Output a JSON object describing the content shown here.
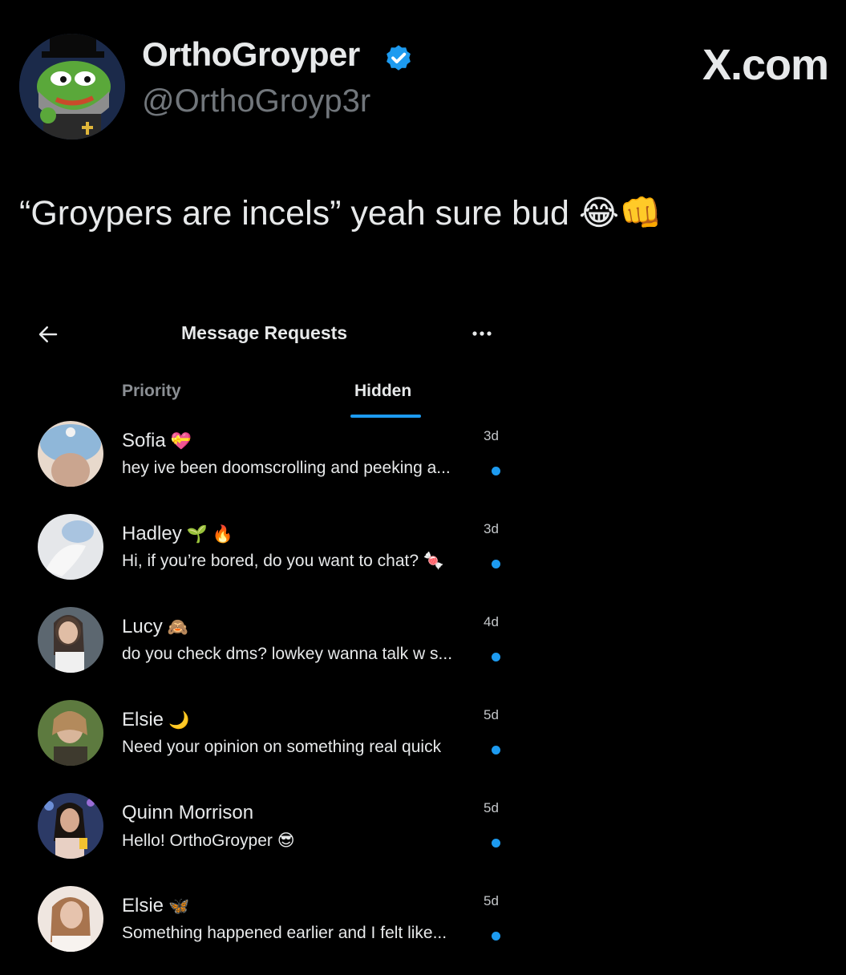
{
  "tweet": {
    "author_name": "OrthoGroyper",
    "author_handle": "@OrthoGroyp3r",
    "verified": true,
    "watermark": "X.com",
    "text": "“Groypers are incels” yeah sure bud 😂👊"
  },
  "dm_screen": {
    "title": "Message Requests",
    "tabs": [
      {
        "label": "Priority",
        "active": false
      },
      {
        "label": "Hidden",
        "active": true
      }
    ],
    "conversations": [
      {
        "name": "Sofia",
        "name_emoji": "💝",
        "time": "3d",
        "preview": "hey ive been doomscrolling and peeking a...",
        "unread": true,
        "avatar_color": "#8fb7d9"
      },
      {
        "name": "Hadley",
        "name_emoji": "🌱 🔥",
        "time": "3d",
        "preview": "Hi, if you’re bored, do you want to chat? 🍬",
        "unread": true,
        "avatar_color": "#d9dde3"
      },
      {
        "name": "Lucy",
        "name_emoji": "🙈",
        "time": "4d",
        "preview": "do you check dms? lowkey wanna talk w s...",
        "unread": true,
        "avatar_color": "#6e6258"
      },
      {
        "name": "Elsie",
        "name_emoji": "🌙",
        "time": "5d",
        "preview": "Need your opinion on something real quick",
        "unread": true,
        "avatar_color": "#5d7a3f"
      },
      {
        "name": "Quinn Morrison",
        "name_emoji": "",
        "time": "5d",
        "preview": "Hello!  OrthoGroyper 😎",
        "unread": true,
        "avatar_color": "#2c3a66"
      },
      {
        "name": "Elsie",
        "name_emoji": "🦋",
        "time": "5d",
        "preview": "Something happened earlier and I felt like...",
        "unread": true,
        "avatar_color": "#d6b9a8"
      }
    ]
  },
  "colors": {
    "background": "#000000",
    "accent": "#1d9bf0",
    "secondary_text": "#71767b"
  }
}
